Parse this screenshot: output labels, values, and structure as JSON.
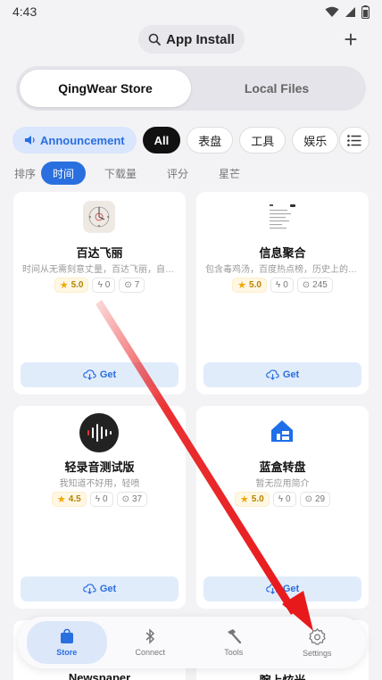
{
  "status_bar": {
    "time": "4:43"
  },
  "header": {
    "title": "App Install",
    "add_label": "+"
  },
  "segments": [
    {
      "label": "QingWear Store",
      "active": true
    },
    {
      "label": "Local Files",
      "active": false
    }
  ],
  "filters": {
    "announcement": "Announcement",
    "chips": [
      "All",
      "表盘",
      "工具",
      "娱乐"
    ]
  },
  "sort": {
    "label": "排序",
    "options": [
      "时间",
      "下载量",
      "评分",
      "星芒"
    ]
  },
  "get_label": "Get",
  "apps": [
    {
      "name": "百达飞丽",
      "desc": "时间从无需刻意丈量，百达飞丽，自为…",
      "rating": "5.0",
      "likes": "0",
      "downloads": "7",
      "rating_color": "#f0a800"
    },
    {
      "name": "信息聚合",
      "desc": "包含毒鸡汤，百度热点榜，历史上的今…",
      "rating": "5.0",
      "likes": "0",
      "downloads": "245",
      "rating_color": "#f0a800"
    },
    {
      "name": "轻录音测试版",
      "desc": "我知道不好用，轻喷",
      "rating": "4.5",
      "likes": "0",
      "downloads": "37",
      "rating_color": "#f0a800"
    },
    {
      "name": "蓝盒转盘",
      "desc": "暂无应用简介",
      "rating": "5.0",
      "likes": "0",
      "downloads": "29",
      "rating_color": "#f0a800"
    }
  ],
  "partial_apps": [
    "Newspaper",
    "腕上炫光"
  ],
  "nav": [
    {
      "label": "Store",
      "active": true
    },
    {
      "label": "Connect",
      "active": false
    },
    {
      "label": "Tools",
      "active": false
    },
    {
      "label": "Settings",
      "active": false
    }
  ],
  "colors": {
    "accent": "#2a6fe0",
    "annotation_arrow": "#e8191b"
  }
}
